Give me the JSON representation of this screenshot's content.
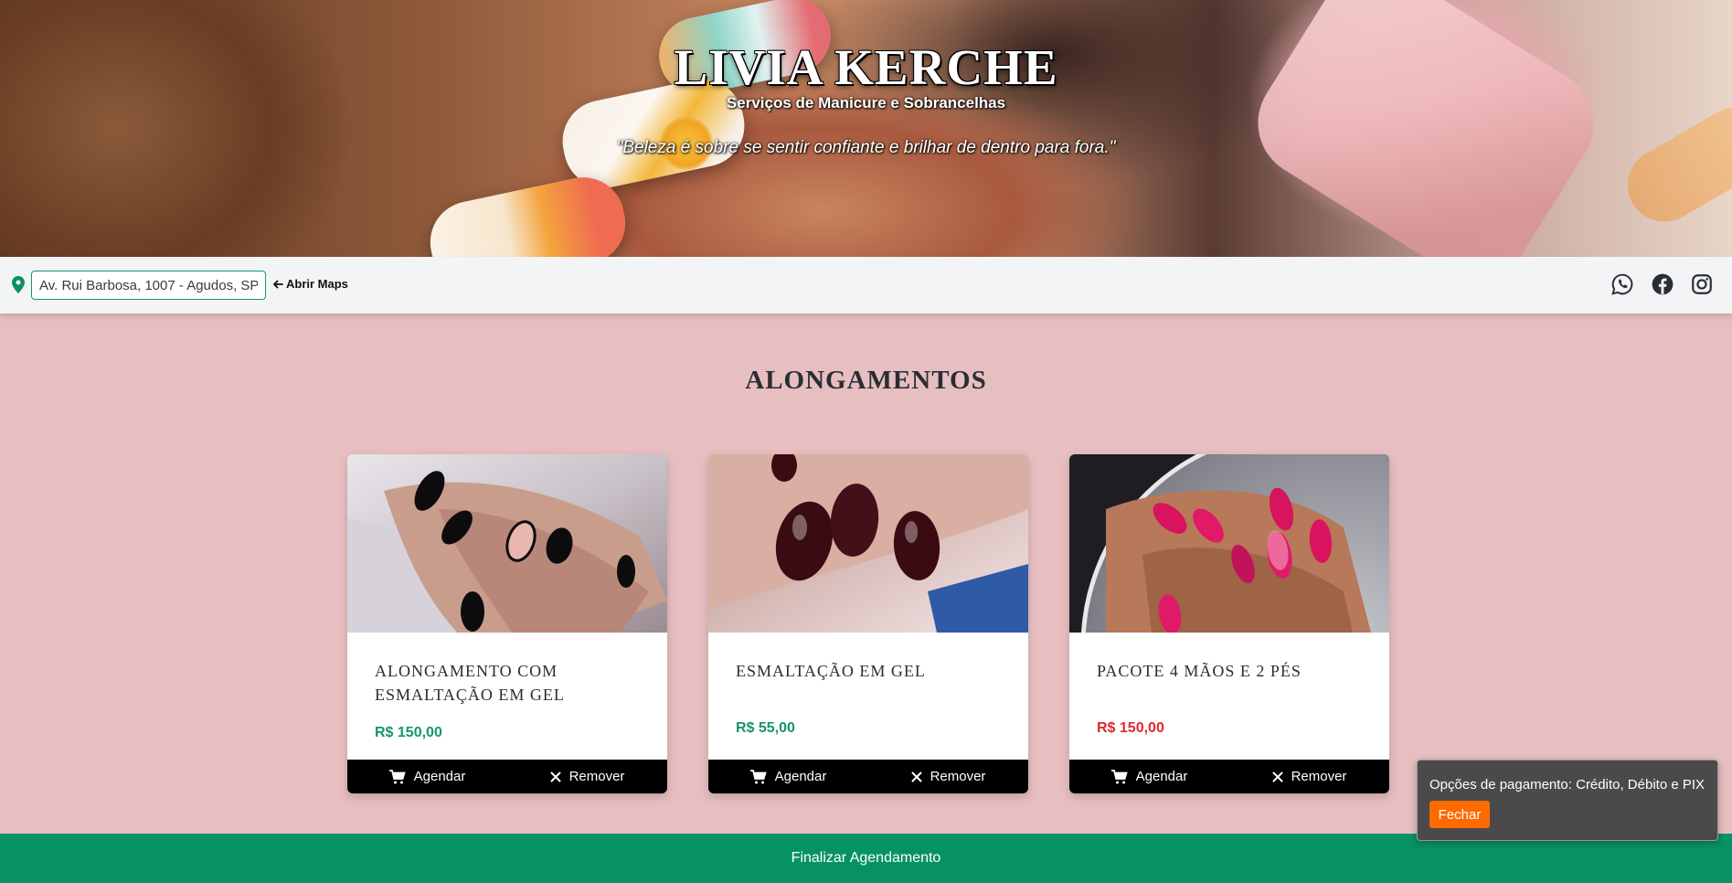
{
  "header": {
    "title": "LIVIA KERCHE",
    "subtitle": "Serviços de Manicure e Sobrancelhas",
    "quote": "\"Beleza é sobre se sentir confiante e brilhar de dentro para fora.\""
  },
  "infobar": {
    "address_value": "Av. Rui Barbosa, 1007 - Agudos, SP",
    "maps_label": "Abrir Maps",
    "social_icons": [
      "whatsapp-icon",
      "facebook-icon",
      "instagram-icon"
    ]
  },
  "section": {
    "title": "ALONGAMENTOS"
  },
  "cards": [
    {
      "name": "ALONGAMENTO COM ESMALTAÇÃO EM GEL",
      "price": "R$ 150,00",
      "price_color": "#17966a",
      "schedule_label": "Agendar",
      "remove_label": "Remover"
    },
    {
      "name": "ESMALTAÇÃO EM GEL",
      "price": "R$ 55,00",
      "price_color": "#17966a",
      "schedule_label": "Agendar",
      "remove_label": "Remover"
    },
    {
      "name": "PACOTE 4 MÃOS E 2 PÉS",
      "price": "R$ 150,00",
      "price_color": "#e0282e",
      "schedule_label": "Agendar",
      "remove_label": "Remover"
    }
  ],
  "footer": {
    "finalize_label": "Finalizar Agendamento"
  },
  "toast": {
    "message": "Opções de pagamento: Crédito, Débito e PIX",
    "close_label": "Fechar"
  },
  "colors": {
    "accent_green": "#079266",
    "background": "#e7bfc0",
    "toast_button": "#ff6a00"
  }
}
